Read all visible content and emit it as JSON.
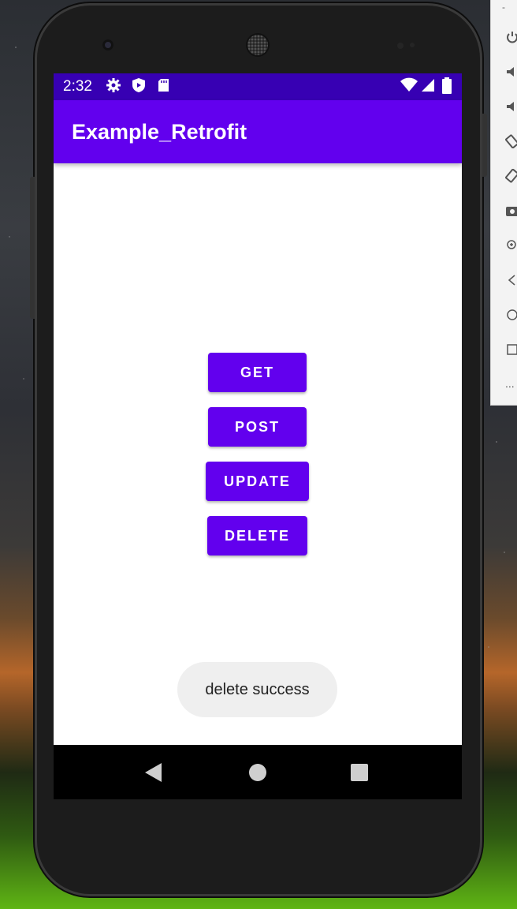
{
  "status_bar": {
    "time": "2:32",
    "icons": [
      "settings-icon",
      "shield-icon",
      "sd-card-icon",
      "wifi-icon",
      "signal-icon",
      "battery-icon"
    ]
  },
  "app_bar": {
    "title": "Example_Retrofit"
  },
  "buttons": {
    "get": "GET",
    "post": "POST",
    "update": "UPDATE",
    "delete": "DELETE"
  },
  "toast": {
    "message": "delete success"
  },
  "nav_bar": {
    "icons": [
      "back-icon",
      "home-icon",
      "recents-icon"
    ]
  },
  "emulator_panel": {
    "dash": "-",
    "controls": [
      "power-icon",
      "volume-up-icon",
      "volume-down-icon",
      "rotate-left-icon",
      "rotate-right-icon",
      "camera-icon",
      "zoom-icon",
      "back-icon",
      "home-icon",
      "overview-icon",
      "more-icon"
    ],
    "more_label": "..."
  },
  "colors": {
    "status_bar": "#3700b3",
    "primary": "#6200ee",
    "toast_bg": "#efefef"
  }
}
